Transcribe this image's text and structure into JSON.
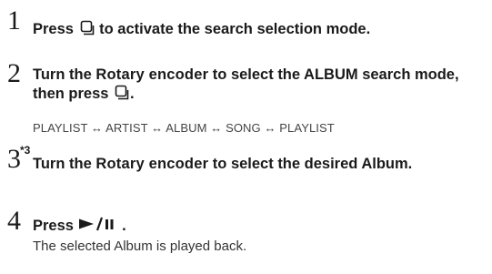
{
  "steps": [
    {
      "number": "1",
      "before": "Press ",
      "icon": "search-button-icon",
      "after": " to activate the search selection mode."
    },
    {
      "number": "2",
      "before": "Turn the ",
      "emphasis": "Rotary encoder",
      "middle": " to select the ALBUM search mode, then press ",
      "icon": "search-button-icon",
      "after": "."
    },
    {
      "number": "3",
      "superscript": "*3",
      "before": "Turn the ",
      "emphasis": "Rotary encoder",
      "after": " to select the desired Album."
    },
    {
      "number": "4",
      "before": "Press ",
      "icon": "play-pause-icon",
      "after": " .",
      "result": "The selected Album is played back."
    }
  ],
  "search_sequence": "PLAYLIST ↔ ARTIST ↔ ALBUM ↔ SONG ↔ PLAYLIST"
}
